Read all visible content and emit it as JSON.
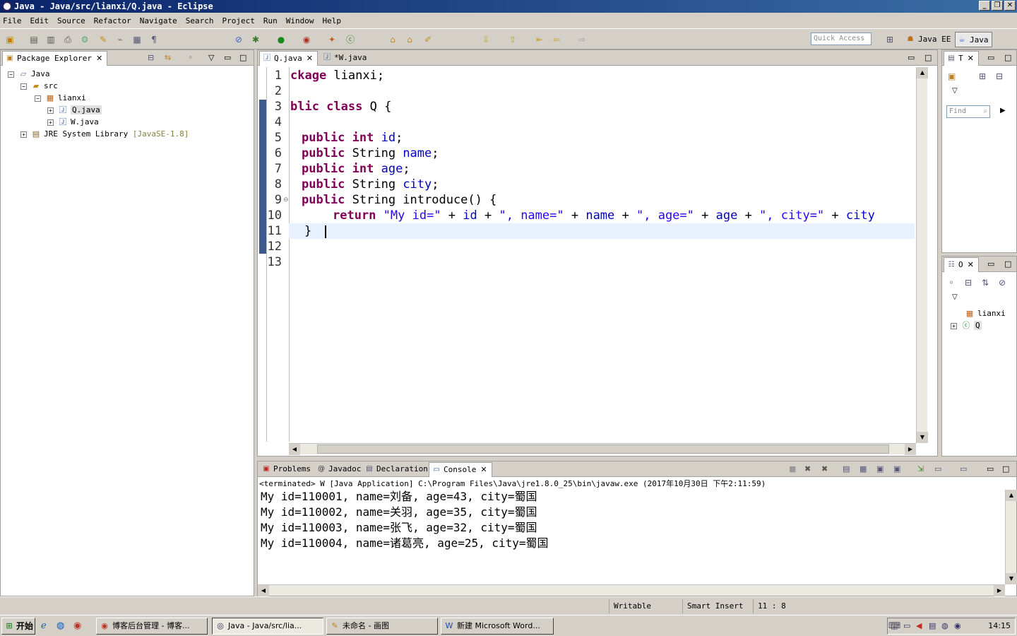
{
  "window": {
    "title": "Java - Java/src/lianxi/Q.java - Eclipse"
  },
  "menu": [
    "File",
    "Edit",
    "Source",
    "Refactor",
    "Navigate",
    "Search",
    "Project",
    "Run",
    "Window",
    "Help"
  ],
  "toolbar": {
    "quick_access_placeholder": "Quick Access",
    "perspectives": [
      "Java EE",
      "Java"
    ]
  },
  "package_explorer": {
    "tab": "Package Explorer",
    "tree": [
      {
        "label": "Java",
        "depth": 0,
        "icon": "project-icon"
      },
      {
        "label": "src",
        "depth": 1,
        "icon": "source-folder-icon"
      },
      {
        "label": "lianxi",
        "depth": 2,
        "icon": "package-icon"
      },
      {
        "label": "Q.java",
        "depth": 3,
        "icon": "java-file-icon",
        "selected": true
      },
      {
        "label": "W.java",
        "depth": 3,
        "icon": "java-file-icon"
      },
      {
        "label": "JRE System Library",
        "decoration": "[JavaSE-1.8]",
        "depth": 1,
        "icon": "library-icon"
      }
    ]
  },
  "editor": {
    "tabs": [
      {
        "label": "Q.java",
        "active": true
      },
      {
        "label": "*W.java",
        "active": false
      }
    ],
    "lines": [
      "1",
      "2",
      "3",
      "4",
      "5",
      "6",
      "7",
      "8",
      "9",
      "10",
      "11",
      "12",
      "13"
    ],
    "code": {
      "l1_kw": "ckage",
      "l1_rest": " lianxi;",
      "l3_kw": "blic class",
      "l3_rest": " Q {",
      "l5_kw": "public int",
      "l5_fld": "id",
      "l6_kw": "public",
      "l6_type": " String ",
      "l6_fld": "name",
      "l7_kw": "public int",
      "l7_fld": "age",
      "l8_kw": "public",
      "l8_type": " String ",
      "l8_fld": "city",
      "l9_kw": "public",
      "l9_rest": " String introduce() {",
      "l10_kw": "return",
      "l10_s1": "\"My id=\"",
      "l10_f1": "id",
      "l10_s2": "\", name=\"",
      "l10_f2": "name",
      "l10_s3": "\", age=\"",
      "l10_f3": "age",
      "l10_s4": "\", city=\"",
      "l10_f4": "city",
      "l11": "}"
    }
  },
  "outline_top": {
    "tab": "T",
    "find_placeholder": "Find"
  },
  "outline": {
    "tab": "O",
    "items": [
      "lianxi",
      "Q"
    ]
  },
  "bottom_tabs": [
    "Problems",
    "Javadoc",
    "Declaration",
    "Console"
  ],
  "console": {
    "header": "<terminated> W [Java Application] C:\\Program Files\\Java\\jre1.8.0_25\\bin\\javaw.exe (2017年10月30日 下午2:11:59)",
    "lines": [
      "My id=110001, name=刘备, age=43, city=蜀国",
      "My id=110002, name=关羽, age=35, city=蜀国",
      "My id=110003, name=张飞, age=32, city=蜀国",
      "My id=110004, name=诸葛亮, age=25, city=蜀国"
    ]
  },
  "status": {
    "writable": "Writable",
    "insert_mode": "Smart Insert",
    "position": "11 : 8"
  },
  "taskbar": {
    "start": "开始",
    "tasks": [
      "博客后台管理 - 博客...",
      "Java - Java/src/lia...",
      "未命名 - 画图",
      "新建 Microsoft Word..."
    ],
    "clock": "14:15"
  }
}
